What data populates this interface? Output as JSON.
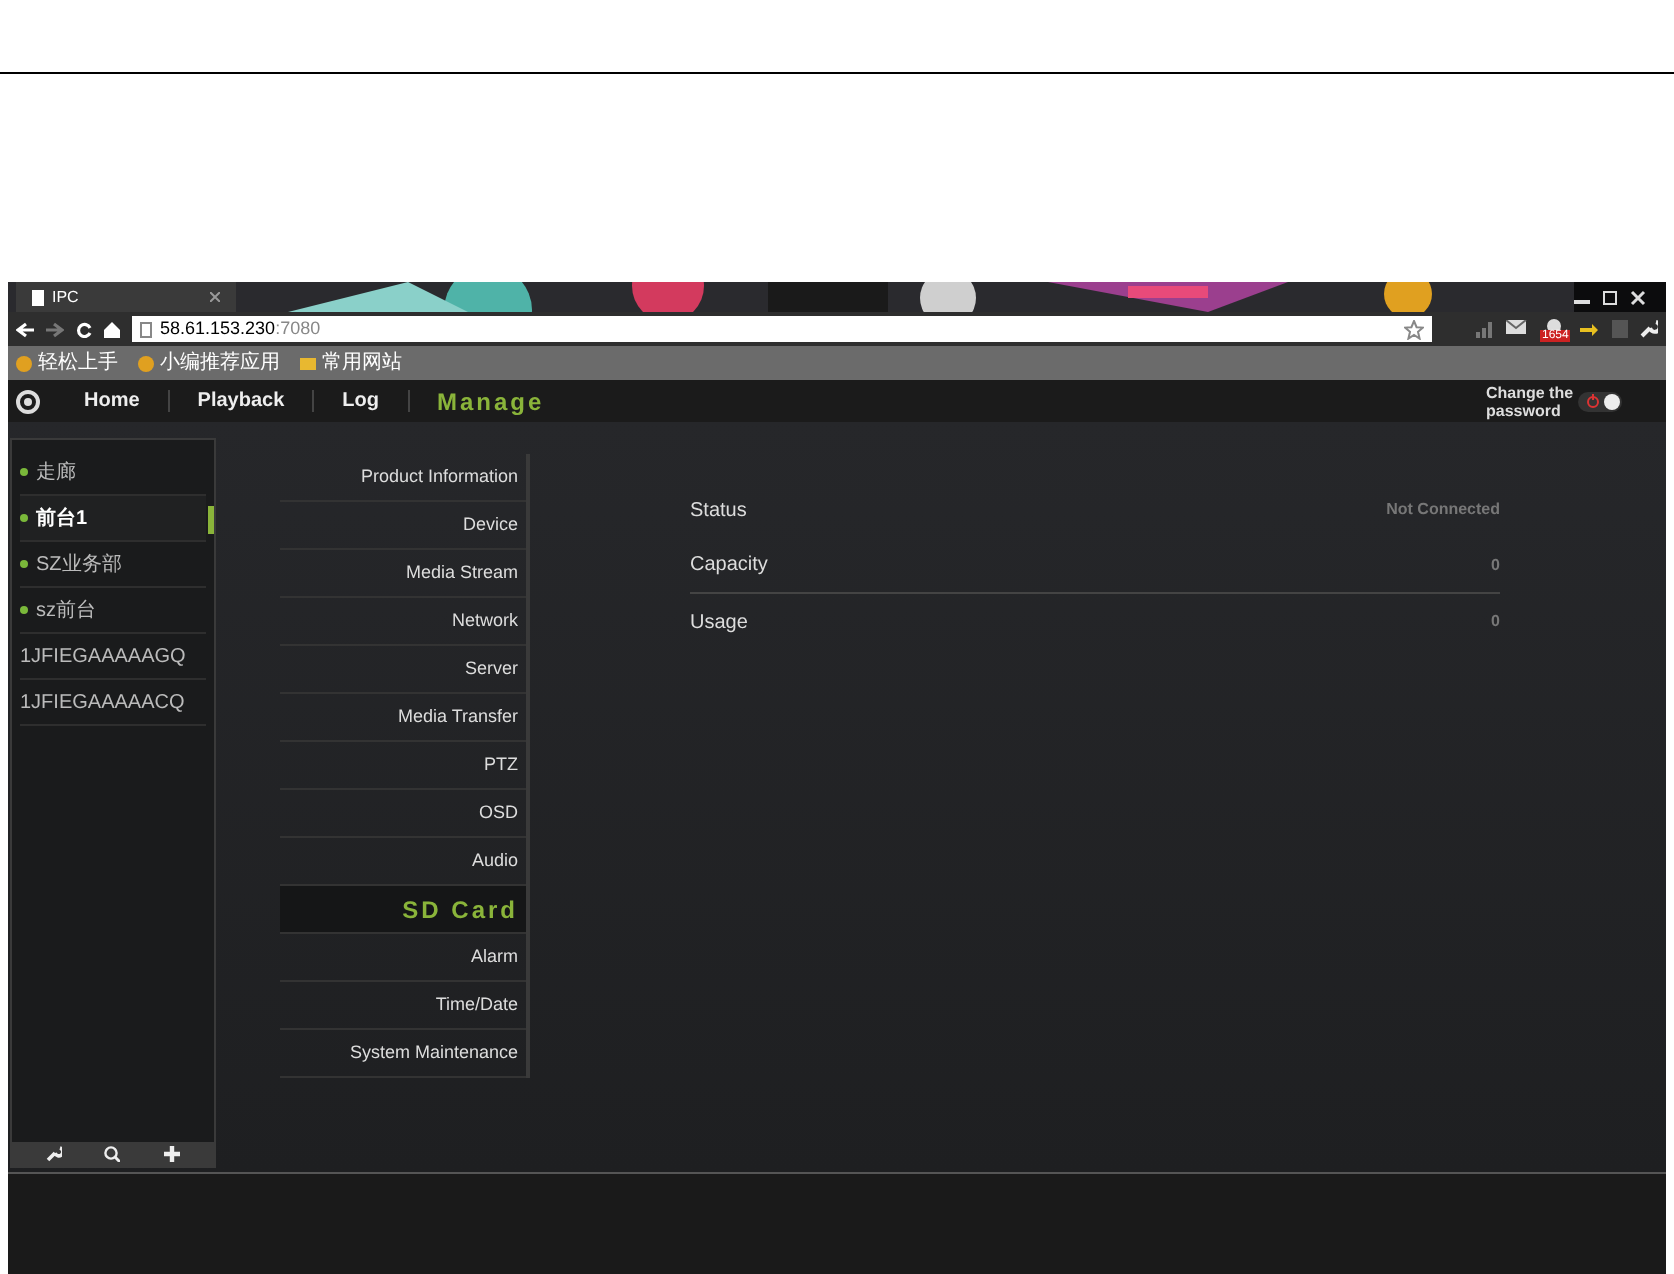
{
  "browser": {
    "tab_title": "IPC",
    "address": "58.61.153.230",
    "port": ":7080",
    "badge": "1654",
    "bookmarks": [
      {
        "label": "轻松上手",
        "kind": "app"
      },
      {
        "label": "小编推荐应用",
        "kind": "app"
      },
      {
        "label": "常用网站",
        "kind": "folder"
      }
    ]
  },
  "nav": {
    "items": [
      {
        "label": "Home",
        "selected": false
      },
      {
        "label": "Playback",
        "selected": false
      },
      {
        "label": "Log",
        "selected": false
      },
      {
        "label": "Manage",
        "selected": true
      }
    ],
    "account": "Change the password",
    "power_on": true
  },
  "devices": [
    {
      "name": "走廊",
      "online": true,
      "selected": false
    },
    {
      "name": "前台1",
      "online": true,
      "selected": true
    },
    {
      "name": "SZ业务部",
      "online": true,
      "selected": false
    },
    {
      "name": "sz前台",
      "online": true,
      "selected": false
    },
    {
      "name": "1JFIEGAAAAAGQ",
      "online": false,
      "selected": false
    },
    {
      "name": "1JFIEGAAAAACQ",
      "online": false,
      "selected": false
    }
  ],
  "settings_menu": [
    {
      "label": "Product Information",
      "selected": false
    },
    {
      "label": "Device",
      "selected": false
    },
    {
      "label": "Media Stream",
      "selected": false
    },
    {
      "label": "Network",
      "selected": false
    },
    {
      "label": "Server",
      "selected": false
    },
    {
      "label": "Media Transfer",
      "selected": false
    },
    {
      "label": "PTZ",
      "selected": false
    },
    {
      "label": "OSD",
      "selected": false
    },
    {
      "label": "Audio",
      "selected": false
    },
    {
      "label": "SD Card",
      "selected": true
    },
    {
      "label": "Alarm",
      "selected": false
    },
    {
      "label": "Time/Date",
      "selected": false
    },
    {
      "label": "System Maintenance",
      "selected": false
    }
  ],
  "sd_card": [
    {
      "label": "Status",
      "value": "Not Connected"
    },
    {
      "label": "Capacity",
      "value": "0"
    },
    {
      "label": "Usage",
      "value": "0"
    }
  ]
}
